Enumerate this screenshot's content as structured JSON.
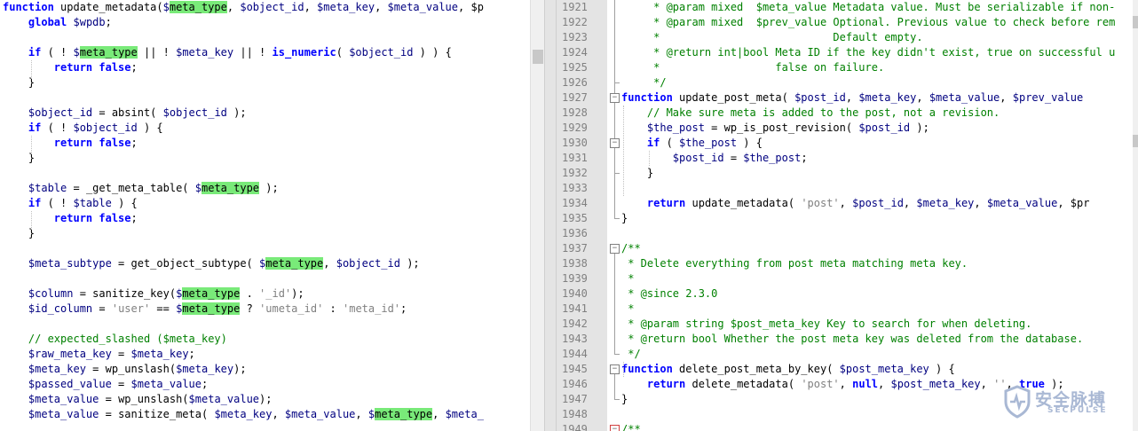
{
  "left_lines": [
    [
      [
        "kw",
        "function"
      ],
      [
        "t",
        " update_metadata("
      ],
      [
        "var",
        "$"
      ],
      [
        "hl",
        "meta_type"
      ],
      [
        "t",
        ", "
      ],
      [
        "var",
        "$object_id"
      ],
      [
        "t",
        ", "
      ],
      [
        "var",
        "$meta_key"
      ],
      [
        "t",
        ", "
      ],
      [
        "var",
        "$meta_value"
      ],
      [
        "t",
        ", $p"
      ]
    ],
    [
      [
        "t",
        "    "
      ],
      [
        "kw",
        "global"
      ],
      [
        "t",
        " "
      ],
      [
        "var",
        "$wpdb"
      ],
      [
        "t",
        ";"
      ]
    ],
    [],
    [
      [
        "t",
        "    "
      ],
      [
        "kw",
        "if"
      ],
      [
        "t",
        " ( ! "
      ],
      [
        "var",
        "$"
      ],
      [
        "hl",
        "meta_type"
      ],
      [
        "t",
        " || ! "
      ],
      [
        "var",
        "$meta_key"
      ],
      [
        "t",
        " || ! "
      ],
      [
        "kw",
        "is_numeric"
      ],
      [
        "t",
        "( "
      ],
      [
        "var",
        "$object_id"
      ],
      [
        "t",
        " ) ) {"
      ]
    ],
    [
      [
        "t",
        "        "
      ],
      [
        "kw",
        "return false"
      ],
      [
        "t",
        ";"
      ]
    ],
    [
      [
        "t",
        "    }"
      ]
    ],
    [],
    [
      [
        "t",
        "    "
      ],
      [
        "var",
        "$object_id"
      ],
      [
        "t",
        " = absint( "
      ],
      [
        "var",
        "$object_id"
      ],
      [
        "t",
        " );"
      ]
    ],
    [
      [
        "t",
        "    "
      ],
      [
        "kw",
        "if"
      ],
      [
        "t",
        " ( ! "
      ],
      [
        "var",
        "$object_id"
      ],
      [
        "t",
        " ) {"
      ]
    ],
    [
      [
        "t",
        "        "
      ],
      [
        "kw",
        "return false"
      ],
      [
        "t",
        ";"
      ]
    ],
    [
      [
        "t",
        "    }"
      ]
    ],
    [],
    [
      [
        "t",
        "    "
      ],
      [
        "var",
        "$table"
      ],
      [
        "t",
        " = _get_meta_table( "
      ],
      [
        "var",
        "$"
      ],
      [
        "hl",
        "meta_type"
      ],
      [
        "t",
        " );"
      ]
    ],
    [
      [
        "t",
        "    "
      ],
      [
        "kw",
        "if"
      ],
      [
        "t",
        " ( ! "
      ],
      [
        "var",
        "$table"
      ],
      [
        "t",
        " ) {"
      ]
    ],
    [
      [
        "t",
        "        "
      ],
      [
        "kw",
        "return false"
      ],
      [
        "t",
        ";"
      ]
    ],
    [
      [
        "t",
        "    }"
      ]
    ],
    [],
    [
      [
        "t",
        "    "
      ],
      [
        "var",
        "$meta_subtype"
      ],
      [
        "t",
        " = get_object_subtype( "
      ],
      [
        "var",
        "$"
      ],
      [
        "hl",
        "meta_type"
      ],
      [
        "t",
        ", "
      ],
      [
        "var",
        "$object_id"
      ],
      [
        "t",
        " );"
      ]
    ],
    [],
    [
      [
        "t",
        "    "
      ],
      [
        "var",
        "$column"
      ],
      [
        "t",
        " = sanitize_key("
      ],
      [
        "var",
        "$"
      ],
      [
        "hl",
        "meta_type"
      ],
      [
        "t",
        " . "
      ],
      [
        "str",
        "'_id'"
      ],
      [
        "t",
        ");"
      ]
    ],
    [
      [
        "t",
        "    "
      ],
      [
        "var",
        "$id_column"
      ],
      [
        "t",
        " = "
      ],
      [
        "str",
        "'user'"
      ],
      [
        "t",
        " == "
      ],
      [
        "var",
        "$"
      ],
      [
        "hl",
        "meta_type"
      ],
      [
        "t",
        " ? "
      ],
      [
        "str",
        "'umeta_id'"
      ],
      [
        "t",
        " : "
      ],
      [
        "str",
        "'meta_id'"
      ],
      [
        "t",
        ";"
      ]
    ],
    [],
    [
      [
        "t",
        "    "
      ],
      [
        "cm",
        "// expected_slashed ($meta_key)"
      ]
    ],
    [
      [
        "t",
        "    "
      ],
      [
        "var",
        "$raw_meta_key"
      ],
      [
        "t",
        " = "
      ],
      [
        "var",
        "$meta_key"
      ],
      [
        "t",
        ";"
      ]
    ],
    [
      [
        "t",
        "    "
      ],
      [
        "var",
        "$meta_key"
      ],
      [
        "t",
        " = wp_unslash("
      ],
      [
        "var",
        "$meta_key"
      ],
      [
        "t",
        ");"
      ]
    ],
    [
      [
        "t",
        "    "
      ],
      [
        "var",
        "$passed_value"
      ],
      [
        "t",
        " = "
      ],
      [
        "var",
        "$meta_value"
      ],
      [
        "t",
        ";"
      ]
    ],
    [
      [
        "t",
        "    "
      ],
      [
        "var",
        "$meta_value"
      ],
      [
        "t",
        " = wp_unslash("
      ],
      [
        "var",
        "$meta_value"
      ],
      [
        "t",
        ");"
      ]
    ],
    [
      [
        "t",
        "    "
      ],
      [
        "var",
        "$meta_value"
      ],
      [
        "t",
        " = sanitize_meta( "
      ],
      [
        "var",
        "$meta_key"
      ],
      [
        "t",
        ", "
      ],
      [
        "var",
        "$meta_value"
      ],
      [
        "t",
        ", "
      ],
      [
        "var",
        "$"
      ],
      [
        "hl",
        "meta_type"
      ],
      [
        "t",
        ", "
      ],
      [
        "var",
        "$meta_"
      ]
    ]
  ],
  "right_lines": [
    {
      "n": "1921",
      "s": [
        [
          "cm",
          "     * @param mixed  $meta_value Metadata value. Must be serializable if non-"
        ]
      ]
    },
    {
      "n": "1922",
      "s": [
        [
          "cm",
          "     * @param mixed  $prev_value Optional. Previous value to check before rem"
        ]
      ]
    },
    {
      "n": "1923",
      "s": [
        [
          "cm",
          "     *                           Default empty."
        ]
      ]
    },
    {
      "n": "1924",
      "s": [
        [
          "cm",
          "     * @return int|bool Meta ID if the key didn't exist, true on successful u"
        ]
      ]
    },
    {
      "n": "1925",
      "s": [
        [
          "cm",
          "     *                  false on failure."
        ]
      ]
    },
    {
      "n": "1926",
      "s": [
        [
          "cm",
          "     */"
        ]
      ]
    },
    {
      "n": "1927",
      "s": [
        [
          "kw",
          "function"
        ],
        [
          "t",
          " update_post_meta( "
        ],
        [
          "var",
          "$post_id"
        ],
        [
          "t",
          ", "
        ],
        [
          "var",
          "$meta_key"
        ],
        [
          "t",
          ", "
        ],
        [
          "var",
          "$meta_value"
        ],
        [
          "t",
          ", "
        ],
        [
          "var",
          "$prev_value"
        ]
      ]
    },
    {
      "n": "1928",
      "s": [
        [
          "t",
          "    "
        ],
        [
          "cm",
          "// Make sure meta is added to the post, not a revision."
        ]
      ]
    },
    {
      "n": "1929",
      "s": [
        [
          "t",
          "    "
        ],
        [
          "var",
          "$the_post"
        ],
        [
          "t",
          " = wp_is_post_revision( "
        ],
        [
          "var",
          "$post_id"
        ],
        [
          "t",
          " );"
        ]
      ]
    },
    {
      "n": "1930",
      "s": [
        [
          "t",
          "    "
        ],
        [
          "kw",
          "if"
        ],
        [
          "t",
          " ( "
        ],
        [
          "var",
          "$the_post"
        ],
        [
          "t",
          " ) {"
        ]
      ]
    },
    {
      "n": "1931",
      "s": [
        [
          "t",
          "        "
        ],
        [
          "var",
          "$post_id"
        ],
        [
          "t",
          " = "
        ],
        [
          "var",
          "$the_post"
        ],
        [
          "t",
          ";"
        ]
      ]
    },
    {
      "n": "1932",
      "s": [
        [
          "t",
          "    }"
        ]
      ]
    },
    {
      "n": "1933",
      "s": []
    },
    {
      "n": "1934",
      "s": [
        [
          "t",
          "    "
        ],
        [
          "kw",
          "return"
        ],
        [
          "t",
          " update_metadata( "
        ],
        [
          "str",
          "'post'"
        ],
        [
          "t",
          ", "
        ],
        [
          "var",
          "$post_id"
        ],
        [
          "t",
          ", "
        ],
        [
          "var",
          "$meta_key"
        ],
        [
          "t",
          ", "
        ],
        [
          "var",
          "$meta_value"
        ],
        [
          "t",
          ", $pr"
        ]
      ]
    },
    {
      "n": "1935",
      "s": [
        [
          "t",
          "}"
        ]
      ]
    },
    {
      "n": "1936",
      "s": []
    },
    {
      "n": "1937",
      "s": [
        [
          "cm",
          "/**"
        ]
      ]
    },
    {
      "n": "1938",
      "s": [
        [
          "cm",
          " * Delete everything from post meta matching meta key."
        ]
      ]
    },
    {
      "n": "1939",
      "s": [
        [
          "cm",
          " *"
        ]
      ]
    },
    {
      "n": "1940",
      "s": [
        [
          "cm",
          " * @since 2.3.0"
        ]
      ]
    },
    {
      "n": "1941",
      "s": [
        [
          "cm",
          " *"
        ]
      ]
    },
    {
      "n": "1942",
      "s": [
        [
          "cm",
          " * @param string $post_meta_key Key to search for when deleting."
        ]
      ]
    },
    {
      "n": "1943",
      "s": [
        [
          "cm",
          " * @return bool Whether the post meta key was deleted from the database."
        ]
      ]
    },
    {
      "n": "1944",
      "s": [
        [
          "cm",
          " */"
        ]
      ]
    },
    {
      "n": "1945",
      "s": [
        [
          "kw",
          "function"
        ],
        [
          "t",
          " delete_post_meta_by_key( "
        ],
        [
          "var",
          "$post_meta_key"
        ],
        [
          "t",
          " ) {"
        ]
      ]
    },
    {
      "n": "1946",
      "s": [
        [
          "t",
          "    "
        ],
        [
          "kw",
          "return"
        ],
        [
          "t",
          " delete_metadata( "
        ],
        [
          "str",
          "'post'"
        ],
        [
          "t",
          ", "
        ],
        [
          "kw",
          "null"
        ],
        [
          "t",
          ", "
        ],
        [
          "var",
          "$post_meta_key"
        ],
        [
          "t",
          ", "
        ],
        [
          "str",
          "''"
        ],
        [
          "t",
          ", "
        ],
        [
          "kw",
          "true"
        ],
        [
          "t",
          " );"
        ]
      ]
    },
    {
      "n": "1947",
      "s": [
        [
          "t",
          "}"
        ]
      ]
    },
    {
      "n": "1948",
      "s": []
    },
    {
      "n": "1949",
      "s": [
        [
          "cm",
          "/**"
        ]
      ]
    }
  ],
  "watermark": {
    "title": "安全脉搏",
    "subtitle": "SECPULSE"
  },
  "colors": {
    "highlight": "#79ea79",
    "keyword": "#0000ff",
    "comment": "#008000",
    "string": "#808080",
    "variable": "#000080"
  }
}
